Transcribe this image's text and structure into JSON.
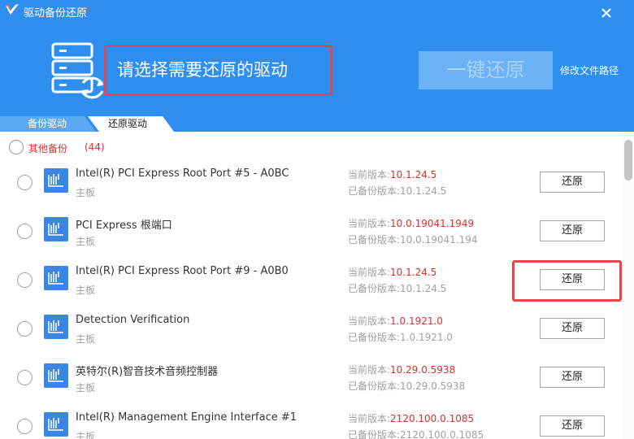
{
  "window": {
    "title": "驱动备份还原",
    "close_icon": "close-icon",
    "logo_icon": "logo-icon"
  },
  "colors": {
    "header": "#2f8ff0",
    "accent_red": "#d93030",
    "highlight_red": "#e24a4a"
  },
  "hero": {
    "icon": "server-restore-icon",
    "prompt": "请选择需要还原的驱动",
    "restore_all_label": "一键还原",
    "modify_path_label": "修改文件路径"
  },
  "tabs": [
    {
      "label": "备份驱动",
      "active": false
    },
    {
      "label": "还原驱动",
      "active": true
    }
  ],
  "filter": {
    "label": "其他备份",
    "count": "(44)"
  },
  "list": {
    "current_label": "当前版本:",
    "backup_label": "已备份版本:",
    "items": [
      {
        "name": "Intel(R) PCI Express Root Port #5 - A0BC",
        "category": "主板",
        "current": "10.1.24.5",
        "backup": "10.1.24.5",
        "button": "还原"
      },
      {
        "name": "PCI Express 根端口",
        "category": "主板",
        "current": "10.0.19041.1949",
        "backup": "10.0.19041.194",
        "button": "还原"
      },
      {
        "name": "Intel(R) PCI Express Root Port #9 - A0B0",
        "category": "主板",
        "current": "10.1.24.5",
        "backup": "10.1.24.5",
        "button": "还原"
      },
      {
        "name": "Detection Verification",
        "category": "主板",
        "current": "1.0.1921.0",
        "backup": "1.0.1921.0",
        "button": "还原"
      },
      {
        "name": "英特尔(R)智音技术音频控制器",
        "category": "主板",
        "current": "10.29.0.5938",
        "backup": "10.29.0.5938",
        "button": "还原"
      },
      {
        "name": "Intel(R) Management Engine Interface #1",
        "category": "主板",
        "current": "2120.100.0.1085",
        "backup": "2120.100.0.1085",
        "button": "还原"
      }
    ]
  }
}
